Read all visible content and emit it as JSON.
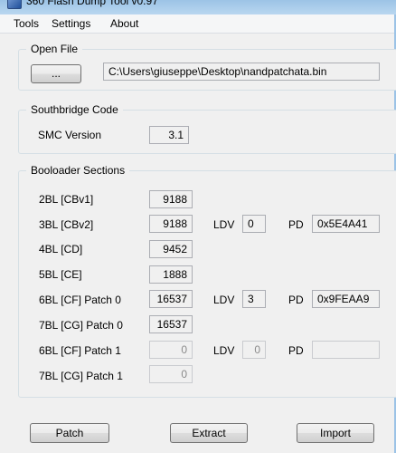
{
  "window": {
    "title": "360 Flash Dump Tool v0.97"
  },
  "menu": {
    "items": [
      "Tools",
      "Settings",
      "About"
    ]
  },
  "open_file": {
    "group_title": "Open File",
    "browse_label": "...",
    "path": "C:\\Users\\giuseppe\\Desktop\\nandpatchata.bin"
  },
  "southbridge": {
    "group_title": "Southbridge Code",
    "smc_label": "SMC Version",
    "smc_value": "3.1"
  },
  "bootloader": {
    "group_title": "Booloader Sections",
    "ldv_label": "LDV",
    "pd_label": "PD",
    "rows": [
      {
        "label": "2BL [CBv1]",
        "value": "9188"
      },
      {
        "label": "3BL [CBv2]",
        "value": "9188",
        "ldv": "0",
        "pd": "0x5E4A41"
      },
      {
        "label": "4BL [CD]",
        "value": "9452"
      },
      {
        "label": "5BL [CE]",
        "value": "1888"
      },
      {
        "label": "6BL [CF] Patch 0",
        "value": "16537",
        "ldv": "3",
        "pd": "0x9FEAA9"
      },
      {
        "label": "7BL [CG] Patch 0",
        "value": "16537"
      },
      {
        "label": "6BL [CF] Patch 1",
        "value": "0",
        "ldv": "0",
        "pd": ""
      },
      {
        "label": "7BL [CG] Patch 1",
        "value": "0"
      }
    ]
  },
  "actions": {
    "patch": "Patch",
    "extract": "Extract",
    "import": "Import"
  }
}
